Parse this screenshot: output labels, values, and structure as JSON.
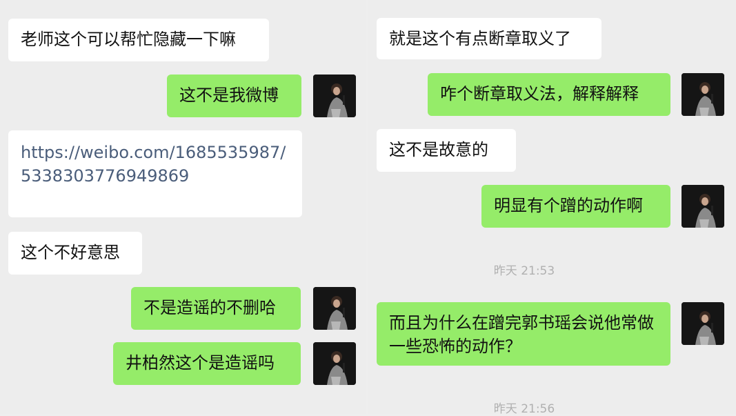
{
  "left_chat": {
    "messages": [
      {
        "side": "received",
        "text": "老师这个可以帮忙隐藏一下嘛"
      },
      {
        "side": "sent",
        "text": "这不是我微博"
      },
      {
        "side": "received",
        "text": "https://weibo.com/1685535987/5338303776949869"
      },
      {
        "side": "received",
        "text": "这个不好意思"
      },
      {
        "side": "sent",
        "text": "不是造谣的不删哈"
      },
      {
        "side": "sent",
        "text": "井柏然这个是造谣吗"
      }
    ]
  },
  "right_chat": {
    "messages": [
      {
        "side": "received",
        "text": "就是这个有点断章取义了"
      },
      {
        "side": "sent",
        "text": "咋个断章取义法，解释解释"
      },
      {
        "side": "received",
        "text": "这不是故意的"
      },
      {
        "side": "sent",
        "text": "明显有个蹭的动作啊"
      },
      {
        "side": "sent",
        "text": "而且为什么在蹭完郭书瑶会说他常做一些恐怖的动作？"
      }
    ],
    "timestamps": [
      "昨天 21:53",
      "昨天 21:56"
    ]
  },
  "colors": {
    "background": "#ededed",
    "received_bubble": "#ffffff",
    "sent_bubble": "#95ec69",
    "link_text": "#4a5d7a",
    "timestamp_text": "#b0b0b0"
  },
  "icons": {
    "avatar": "user-avatar-icon"
  }
}
